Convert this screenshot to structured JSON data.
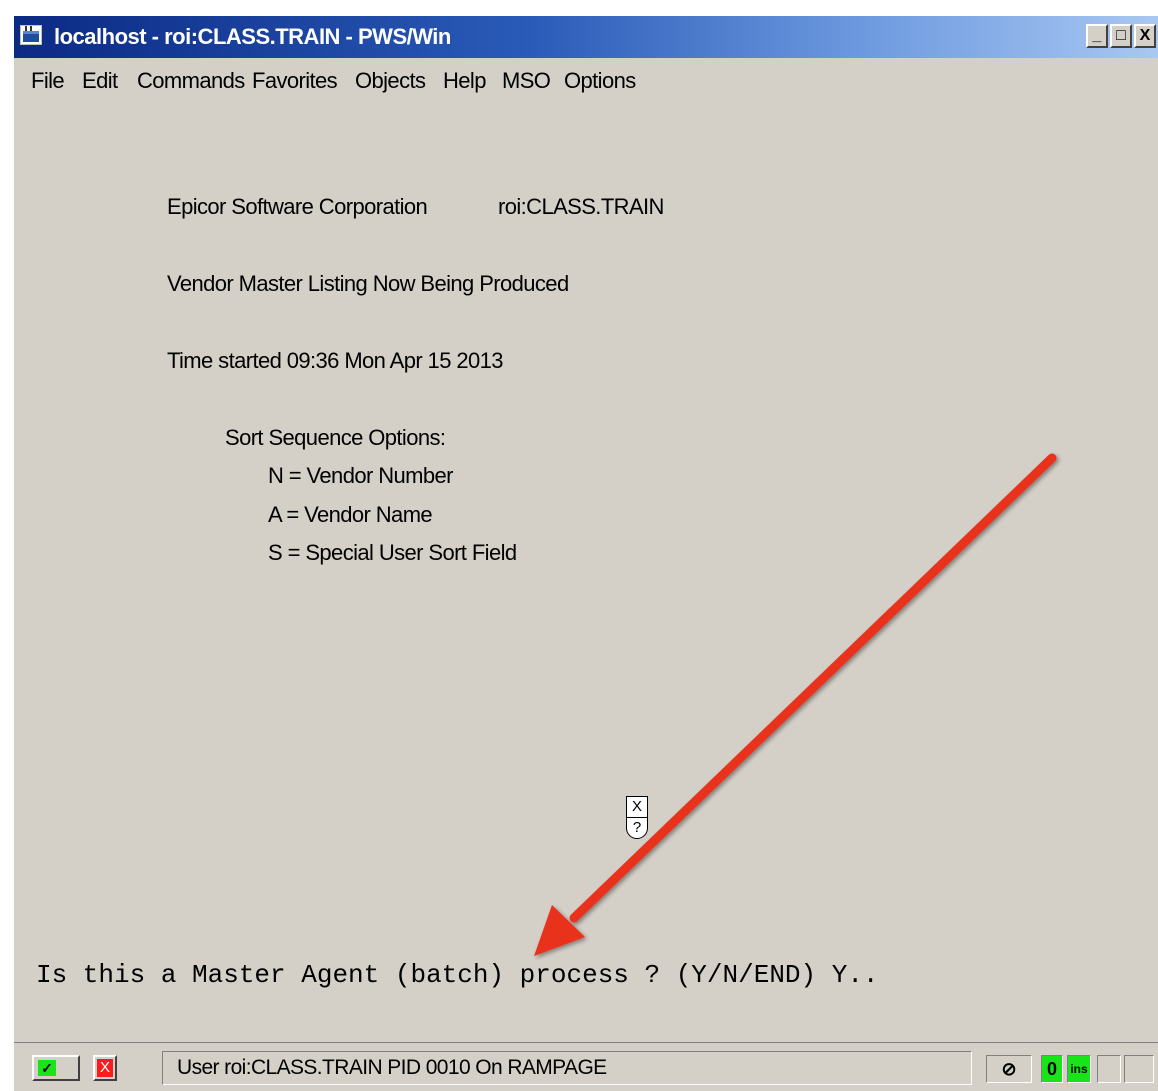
{
  "window": {
    "title": "localhost - roi:CLASS.TRAIN - PWS/Win",
    "minimize": "_",
    "maximize": "□",
    "close": "X"
  },
  "menu": [
    "File",
    "Edit",
    "Commands",
    "Favorites",
    "Objects",
    "Help",
    "MSO",
    "Options"
  ],
  "screen": {
    "company": "Epicor Software Corporation",
    "account": "roi:CLASS.TRAIN",
    "report_title": "Vendor Master Listing Now Being Produced",
    "time_started": "Time started 09:36 Mon Apr 15 2013",
    "sort_heading": "Sort Sequence Options:",
    "sort_options": [
      "N = Vendor Number",
      "A = Vendor Name",
      "S = Special User Sort Field"
    ],
    "prompt": "Is this a Master Agent (batch) process ? (Y/N/END) Y..",
    "cursor_top": "X",
    "cursor_bottom": "?"
  },
  "status": {
    "ok_glyph": "✓",
    "cancel_glyph": "X",
    "session_text": "User roi:CLASS.TRAIN PID 0010 On RAMPAGE",
    "indicator_glyph": "⊘",
    "indicator_zero": "0",
    "indicator_ins": "ins"
  },
  "colors": {
    "arrow": "#e8321e",
    "titlebar_start": "#0b2a84",
    "titlebar_end": "#a9c8f2",
    "window_bg": "#d4d0c8",
    "ok_green": "#19e319",
    "cancel_red": "#ff1a1a"
  }
}
